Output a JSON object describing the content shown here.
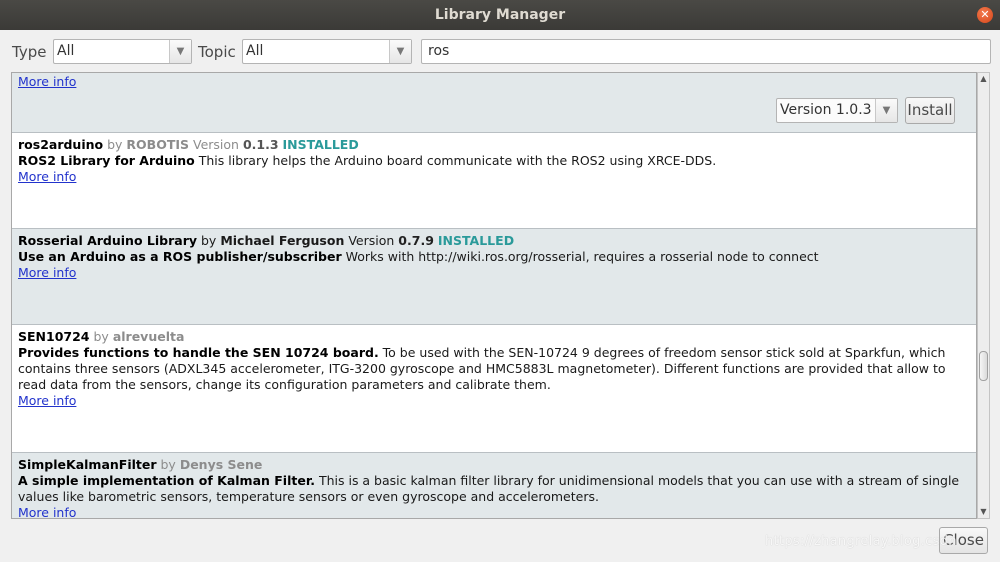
{
  "window": {
    "title": "Library Manager"
  },
  "filters": {
    "type_label": "Type",
    "type_value": "All",
    "topic_label": "Topic",
    "topic_value": "All",
    "search_value": "ros"
  },
  "entries": [
    {
      "more_info": "More info",
      "version_select": "Version 1.0.3",
      "install_label": "Install"
    },
    {
      "name": "ros2arduino",
      "by": "by",
      "author": "ROBOTIS",
      "version_word": "Version",
      "version": "0.1.3",
      "status": "INSTALLED",
      "desc_bold": "ROS2 Library for Arduino",
      "desc": "This library helps the Arduino board communicate with the ROS2 using XRCE-DDS.",
      "more_info": "More info"
    },
    {
      "name": "Rosserial Arduino Library",
      "by": "by",
      "author": "Michael Ferguson",
      "version_word": "Version",
      "version": "0.7.9",
      "status": "INSTALLED",
      "desc_bold": "Use an Arduino as a ROS publisher/subscriber",
      "desc": "Works with http://wiki.ros.org/rosserial, requires a rosserial node to connect",
      "more_info": "More info"
    },
    {
      "name": "SEN10724",
      "by": "by",
      "author": "alrevuelta",
      "desc_bold": "Provides functions to handle the SEN 10724 board.",
      "desc_line1": "To be used with the SEN-10724 9 degrees of freedom sensor stick sold at Sparkfun, which",
      "desc_line2": "contains three sensors (ADXL345 accelerometer, ITG-3200 gyroscope and HMC5883L magnetometer). Different functions are provided that allow to",
      "desc_line3": "read data from the sensors, change its configuration parameters and calibrate them.",
      "more_info": "More info"
    },
    {
      "name": "SimpleKalmanFilter",
      "by": "by",
      "author": "Denys Sene",
      "desc_bold": "A simple implementation of Kalman Filter.",
      "desc_line1": "This is a basic kalman filter library for unidimensional models that you can use with a stream of single",
      "desc_line2": "values like barometric sensors, temperature sensors or even gyroscope and accelerometers.",
      "more_info": "More info"
    }
  ],
  "footer": {
    "close_label": "Close",
    "watermark": "https://zhangrelay.blog.csdn"
  },
  "colors": {
    "installed": "#2a9a9a",
    "link": "#2233cc",
    "row_alt": "#e2e8ea",
    "titlebar": "#3b3a37"
  }
}
